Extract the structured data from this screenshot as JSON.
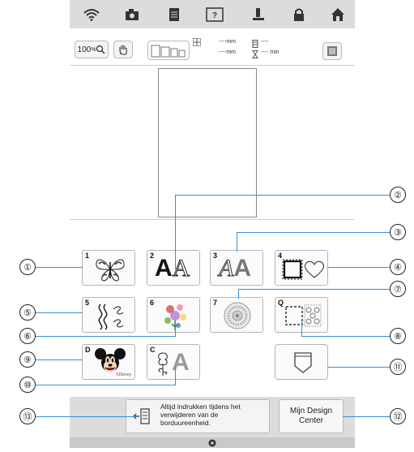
{
  "toolbar": {
    "zoom_label": "100",
    "zoom_unit": "%",
    "dim_width": "----mm",
    "dim_height": "----mm",
    "count_value": "----",
    "time_value": "---- min"
  },
  "categories": [
    {
      "num": "1",
      "icon": "butterfly-icon"
    },
    {
      "num": "2",
      "icon": "character-font-icon",
      "glyph": "AA"
    },
    {
      "num": "3",
      "icon": "decorative-alphabet-icon",
      "glyph": "AA"
    },
    {
      "num": "4",
      "icon": "frame-pattern-icon"
    },
    {
      "num": "5",
      "icon": "utility-stitch-pattern-icon"
    },
    {
      "num": "6",
      "icon": "floral-embroidery-icon"
    },
    {
      "num": "7",
      "icon": "circular-pattern-icon"
    },
    {
      "num": "Q",
      "icon": "quilt-pattern-icon"
    },
    {
      "num": "D",
      "icon": "disney-pattern-icon",
      "caption": "©Disney"
    },
    {
      "num": "C",
      "icon": "couching-pattern-icon",
      "glyph": "A"
    }
  ],
  "message": {
    "text": "Altijd indrukken tijdens het verwijderen van de borduureenheid."
  },
  "my_design_center": {
    "line1": "Mijn Design",
    "line2": "Center"
  },
  "callouts": [
    "①",
    "②",
    "③",
    "④",
    "⑤",
    "⑥",
    "⑦",
    "⑧",
    "⑨",
    "⑩",
    "⑪",
    "⑫",
    "⑬"
  ],
  "colors": {
    "bar": "#dcdcdc",
    "callout_line": "#3a8fd6"
  }
}
